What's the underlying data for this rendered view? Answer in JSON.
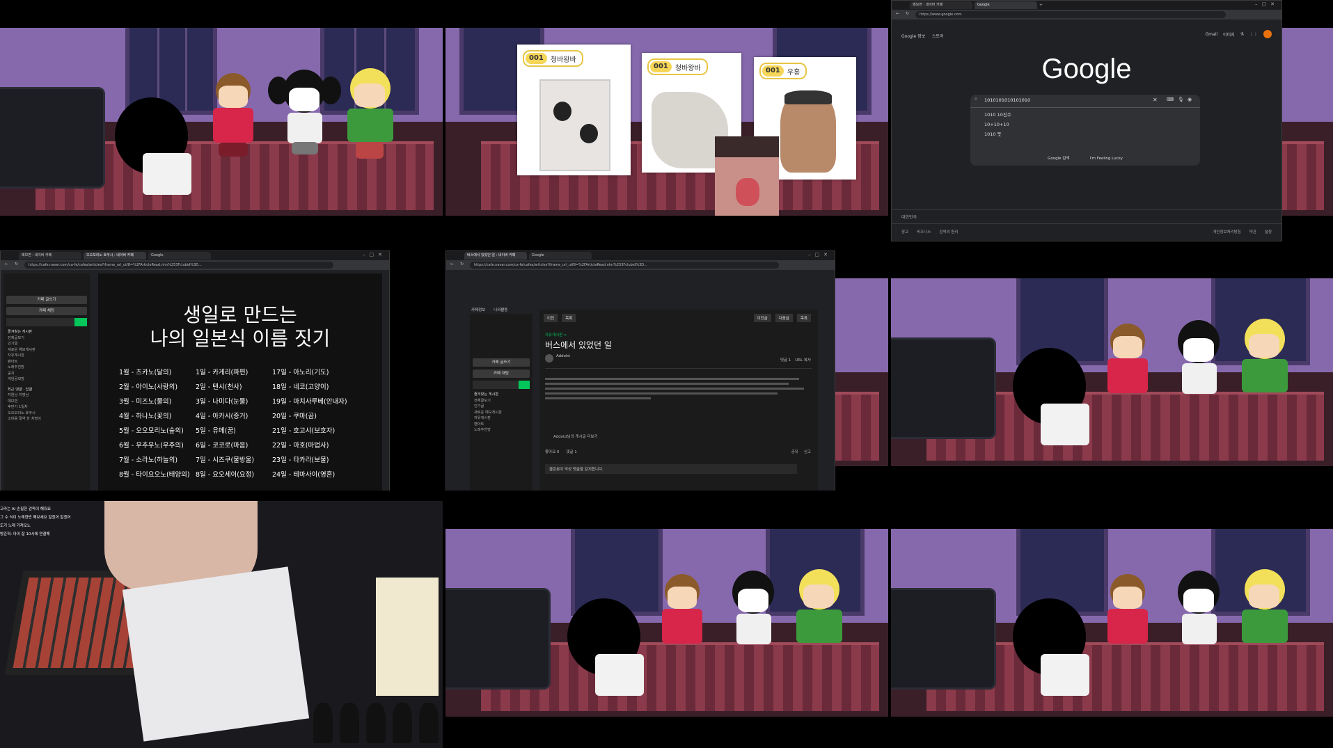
{
  "google_window": {
    "tabs": [
      "왜보면 : 네이버 카페",
      "Google"
    ],
    "url": "https://www.google.com",
    "top_links_left": [
      "Google 정보",
      "스토어"
    ],
    "top_links_right": [
      "Gmail",
      "이미지"
    ],
    "logo": "Google",
    "search_query": "1010101010101010",
    "suggestions": [
      "1010 10진수",
      "10+10+10",
      "1010 뜻"
    ],
    "buttons": [
      "Google 검색",
      "I'm Feeling Lucky"
    ],
    "region": "대한민국",
    "footer_left": [
      "광고",
      "비즈니스",
      "검색의 원리"
    ],
    "footer_right": [
      "개인정보처리방침",
      "약관",
      "설정"
    ]
  },
  "birthday_window": {
    "tabs": [
      "왜보면 : 네이버 카페",
      "오오모리노 호쿠시 : 네이버 카페",
      "Google"
    ],
    "url": "https://cafe.naver.com/ca-fe/cafes/articles?iframe_url_utf8=%2FArticleRead.nhn%253Fclubid%3D...",
    "side_buttons": [
      "카페 글쓰기",
      "카페 채팅"
    ],
    "side_menu": [
      "즐겨찾는 게시판",
      "전체글보기",
      "인기글",
      "새로운 예모게시판",
      "자유게시판",
      "팬아트",
      "노래추천방",
      "공지",
      "게임공략방",
      "최근 댓글 · 답글",
      "지원님 치명님",
      "예보면",
      "후반기 1일차",
      "오오모리노 호쿠시",
      "소비를 절약 한 치명이"
    ],
    "title_line1": "생일로 만드는",
    "title_line2": "나의 일본식 이름 짓기",
    "col1": [
      "1월 - 츠카노(달의)",
      "2월 - 아이노(사랑의)",
      "3월 - 미즈노(물의)",
      "4월 - 하나노(꽃의)",
      "5월 - 오오모리노(숲의)",
      "6월 - 우추우노(우주의)",
      "7월 - 소라노(하늘의)",
      "8월 - 타이요오노(태양의)"
    ],
    "col2": [
      "1일 - 카게리(파편)",
      "2일 - 텐시(천사)",
      "3일 - 나미다(눈물)",
      "4일 - 아카시(증거)",
      "5일 - 유메(꿈)",
      "6일 - 코코로(마음)",
      "7일 - 시즈쿠(물방울)",
      "8일 - 요오세이(요정)"
    ],
    "col3": [
      "17일 - 아노리(기도)",
      "18일 - 네코(고양이)",
      "19일 - 마치사루베(안내자)",
      "20일 - 쿠마(곰)",
      "21일 - 호고샤(보호자)",
      "22일 - 마호(마법사)",
      "23일 - 타카라(보물)",
      "24일 - 테마사이(영혼)"
    ]
  },
  "bus_window": {
    "tabs": [
      "버스에서 있었던 일 : 네이버 카페",
      "Google"
    ],
    "url": "https://cafe.naver.com/ca-fe/cafes/articles?iframe_url_utf8=%2FArticleRead.nhn%253Fclubid%3D...",
    "board_tabs": [
      "카페정보",
      "나의활동"
    ],
    "top_buttons": [
      "이전",
      "목록"
    ],
    "nav_buttons": [
      "이전글",
      "다음글",
      "목록"
    ],
    "category": "자유게시판 >",
    "post_title": "버스에서 있었던 일",
    "author": "Addotd",
    "side_buttons": [
      "카페 글쓰기",
      "카페 채팅"
    ],
    "side_menu": [
      "즐겨찾는 게시판",
      "전체글보기",
      "인기글",
      "새로운 예모게시판",
      "자유게시판",
      "팬아트",
      "노래추천방"
    ],
    "comments": "댓글 1",
    "url_copy": "URL 복사",
    "footer_note": "클린봇이 악성 댓글을 감지합니다.",
    "more_posts": "Addotd님의 게시글 더보기",
    "like": "좋아요 0",
    "comment_count": "댓글 1",
    "share": "공유",
    "report": "신고"
  },
  "cards": [
    {
      "num": "001",
      "label": "청바왕바"
    },
    {
      "num": "001",
      "label": "청바왕바"
    },
    {
      "num": "001",
      "label": "우홍"
    }
  ],
  "chat_lines": [
    "고라는 AI 손필한 감독이 해줘요",
    "그 수 식이 노래한번 해보세요 알겠어 알겠어",
    "도기 노래 가져오노",
    "방준혁: 아이 잘 10시에 연결해"
  ],
  "colors": {
    "accent": "#f5d657",
    "naver_green": "#03c75a",
    "bg": "#000000"
  }
}
